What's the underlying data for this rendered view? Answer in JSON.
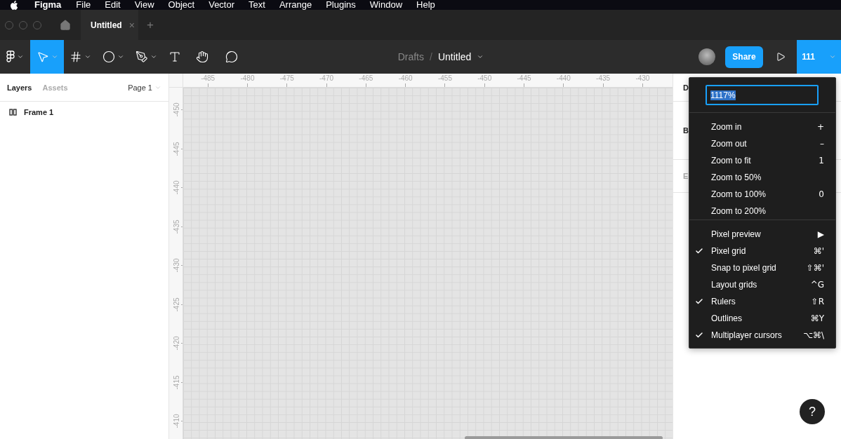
{
  "menubar": {
    "app": "Figma",
    "items": [
      "File",
      "Edit",
      "View",
      "Object",
      "Vector",
      "Text",
      "Arrange",
      "Plugins",
      "Window",
      "Help"
    ]
  },
  "tabs": [
    {
      "label": "Untitled",
      "selected": true,
      "close": "×"
    }
  ],
  "new_tab": "+",
  "toolbar": {
    "tools": [
      {
        "kind": "logo",
        "selected": false,
        "menu": true
      },
      {
        "kind": "move",
        "selected": true,
        "menu": true
      },
      {
        "kind": "frame",
        "selected": false,
        "menu": true
      },
      {
        "kind": "ellipse",
        "selected": false,
        "menu": true
      },
      {
        "kind": "pen",
        "selected": false,
        "menu": true
      },
      {
        "kind": "text",
        "selected": false,
        "menu": false
      },
      {
        "kind": "hand",
        "selected": false,
        "menu": false
      },
      {
        "kind": "comment",
        "selected": false,
        "menu": false
      }
    ],
    "breadcrumb": {
      "folder": "Drafts",
      "separator": "/",
      "file": "Untitled"
    },
    "share": "Share",
    "zoom": "111"
  },
  "left_panel": {
    "tabs": [
      {
        "label": "Layers",
        "selected": true
      },
      {
        "label": "Assets",
        "selected": false
      }
    ],
    "page": "Page 1",
    "layers": [
      {
        "name": "Frame 1"
      }
    ]
  },
  "rulers": {
    "horizontal": [
      "-485",
      "-480",
      "-475",
      "-470",
      "-465",
      "-460",
      "-455",
      "-450",
      "-445",
      "-440",
      "-435",
      "-430"
    ],
    "vertical": [
      "-450",
      "-445",
      "-440",
      "-435",
      "-430",
      "-425",
      "-420",
      "-415",
      "-410"
    ]
  },
  "right_panel": {
    "labels": [
      "D",
      "B",
      "E"
    ]
  },
  "zoom_menu": {
    "value": "1117%",
    "groups": [
      [
        {
          "label": "Zoom in",
          "shortcut": "+",
          "checked": false
        },
        {
          "label": "Zoom out",
          "shortcut": "–",
          "checked": false
        },
        {
          "label": "Zoom to fit",
          "shortcut": "1",
          "checked": false
        },
        {
          "label": "Zoom to 50%",
          "checked": false
        },
        {
          "label": "Zoom to 100%",
          "shortcut": "0",
          "checked": false
        },
        {
          "label": "Zoom to 200%",
          "checked": false
        }
      ],
      [
        {
          "label": "Pixel preview",
          "shortcut": "▶",
          "checked": false
        },
        {
          "label": "Pixel grid",
          "shortcut": "⌘'",
          "checked": true
        },
        {
          "label": "Snap to pixel grid",
          "shortcut": "⇧⌘'",
          "checked": false
        },
        {
          "label": "Layout grids",
          "shortcut": "^G",
          "checked": false
        },
        {
          "label": "Rulers",
          "shortcut": "⇧R",
          "checked": true
        },
        {
          "label": "Outlines",
          "shortcut": "⌘Y",
          "checked": false
        },
        {
          "label": "Multiplayer cursors",
          "shortcut": "⌥⌘\\",
          "checked": true
        }
      ]
    ]
  },
  "help": "?"
}
